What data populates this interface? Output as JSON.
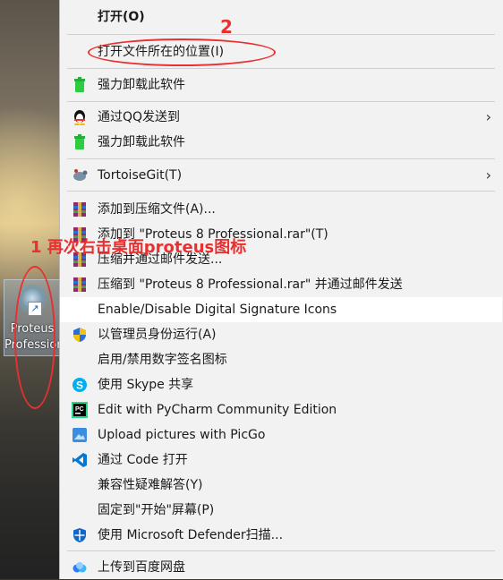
{
  "desktop": {
    "icon_label_line1": "Proteus",
    "icon_label_line2": "Professional",
    "shortcut_arrow": "↗"
  },
  "menu": {
    "items": [
      {
        "label": "打开(O)",
        "icon": "none"
      },
      {
        "label": "打开文件所在的位置(I)",
        "icon": "none"
      },
      {
        "label": "强力卸载此软件",
        "icon": "green-trash-icon"
      },
      {
        "label": "通过QQ发送到",
        "icon": "qq-penguin-icon",
        "submenu": true
      },
      {
        "label": "强力卸载此软件",
        "icon": "green-trash-icon"
      },
      {
        "label": "TortoiseGit(T)",
        "icon": "tortoisegit-icon",
        "submenu": true
      },
      {
        "label": "添加到压缩文件(A)...",
        "icon": "winrar-icon"
      },
      {
        "label": "添加到 \"Proteus 8 Professional.rar\"(T)",
        "icon": "winrar-icon"
      },
      {
        "label": "压缩并通过邮件发送...",
        "icon": "winrar-icon"
      },
      {
        "label": "压缩到 \"Proteus 8 Professional.rar\" 并通过邮件发送",
        "icon": "winrar-icon"
      },
      {
        "label": "Enable/Disable Digital Signature Icons",
        "icon": "none"
      },
      {
        "label": "以管理员身份运行(A)",
        "icon": "uac-shield-icon"
      },
      {
        "label": "启用/禁用数字签名图标",
        "icon": "none"
      },
      {
        "label": "使用 Skype 共享",
        "icon": "skype-icon"
      },
      {
        "label": "Edit with PyCharm Community Edition",
        "icon": "pycharm-icon"
      },
      {
        "label": "Upload pictures with PicGo",
        "icon": "picgo-icon"
      },
      {
        "label": "通过 Code 打开",
        "icon": "vscode-icon"
      },
      {
        "label": "兼容性疑难解答(Y)",
        "icon": "none"
      },
      {
        "label": "固定到\"开始\"屏幕(P)",
        "icon": "none"
      },
      {
        "label": "使用 Microsoft Defender扫描...",
        "icon": "defender-shield-icon"
      },
      {
        "label": "上传到百度网盘",
        "icon": "baidu-netdisk-icon"
      }
    ],
    "submenu_arrow": "›"
  },
  "annotations": {
    "step1": "1 再次右击桌面proteus图标",
    "step2": "2",
    "color": "#e83030"
  }
}
